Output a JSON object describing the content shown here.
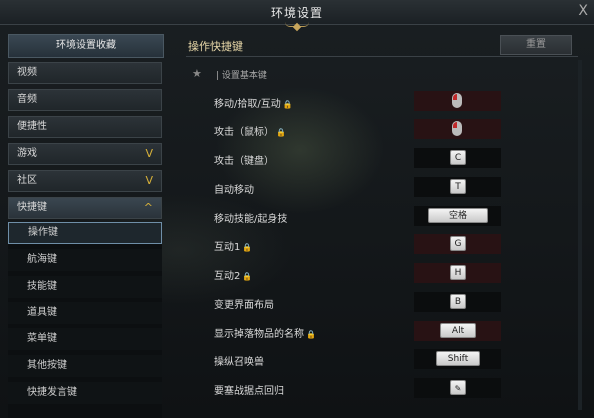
{
  "window": {
    "title": "环境设置",
    "close": "X"
  },
  "sidebar": {
    "header": "环境设置收藏",
    "items": [
      {
        "label": "视频"
      },
      {
        "label": "音频"
      },
      {
        "label": "便捷性"
      },
      {
        "label": "游戏",
        "chevron": "V"
      },
      {
        "label": "社区",
        "chevron": "V"
      },
      {
        "label": "快捷键",
        "chevron": "^"
      }
    ],
    "subitems": [
      "操作键",
      "航海键",
      "技能键",
      "道具键",
      "菜单键",
      "其他按键",
      "快捷发言键"
    ]
  },
  "main": {
    "section_title": "操作快捷键",
    "reset_label": "重置",
    "basic_label": "设置基本键",
    "rows": [
      {
        "label": "移动/拾取/互动",
        "lock": true,
        "key": "mouse-right"
      },
      {
        "label": "攻击（鼠标）",
        "lock": true,
        "key": "mouse-left"
      },
      {
        "label": "攻击（键盘）",
        "key": "C"
      },
      {
        "label": "自动移动",
        "key": "T"
      },
      {
        "label": "移动技能/起身技",
        "key": "空格"
      },
      {
        "label": "互动1",
        "lock": true,
        "key": "G"
      },
      {
        "label": "互动2",
        "lock": true,
        "key": "H"
      },
      {
        "label": "变更界面布局",
        "key": "B"
      },
      {
        "label": "显示掉落物品的名称",
        "lock": true,
        "key": "Alt"
      },
      {
        "label": "操纵召唤兽",
        "key": "Shift"
      },
      {
        "label": "要塞战据点回归",
        "key": "pencil-icon"
      }
    ]
  },
  "colors": {
    "accent_gold": "#d8b23a",
    "section_title": "#e8d8a8",
    "red_slot": "#281214"
  }
}
